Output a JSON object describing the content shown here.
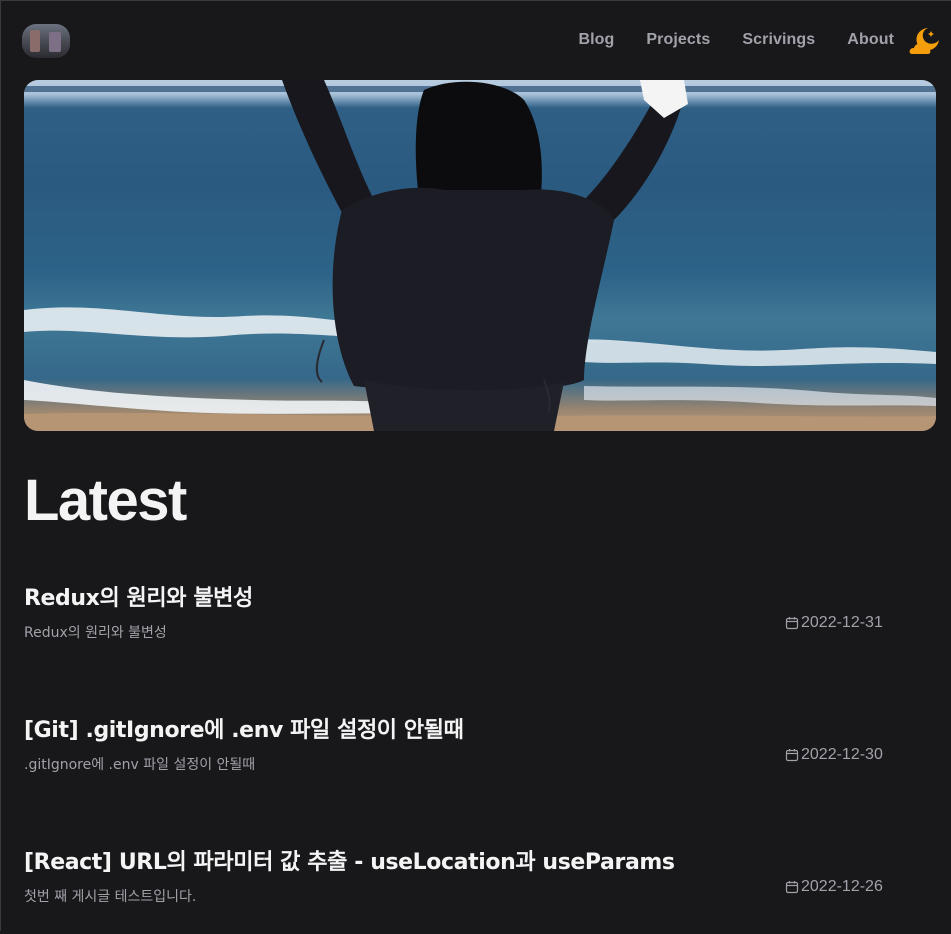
{
  "header": {
    "nav": [
      "Blog",
      "Projects",
      "Scrivings",
      "About"
    ],
    "theme_toggle_icon": "moon-cloud-icon"
  },
  "hero": {
    "image": "beach-photo"
  },
  "main": {
    "heading": "Latest",
    "posts": [
      {
        "title": "Redux의 원리와 불변성",
        "description": "Redux의 원리와 불변성",
        "date": "2022-12-31"
      },
      {
        "title": "[Git] .gitIgnore에 .env 파일 설정이 안될때",
        "description": ".gitIgnore에 .env 파일 설정이 안될때",
        "date": "2022-12-30"
      },
      {
        "title": "[React] URL의 파라미터 값 추출 - useLocation과 useParams",
        "description": "첫번 째 게시글 테스트입니다.",
        "date": "2022-12-26"
      }
    ]
  },
  "colors": {
    "background": "#18181a",
    "text": "#f4f4f5",
    "muted": "#a1a1aa",
    "accent": "#f59e0b"
  }
}
